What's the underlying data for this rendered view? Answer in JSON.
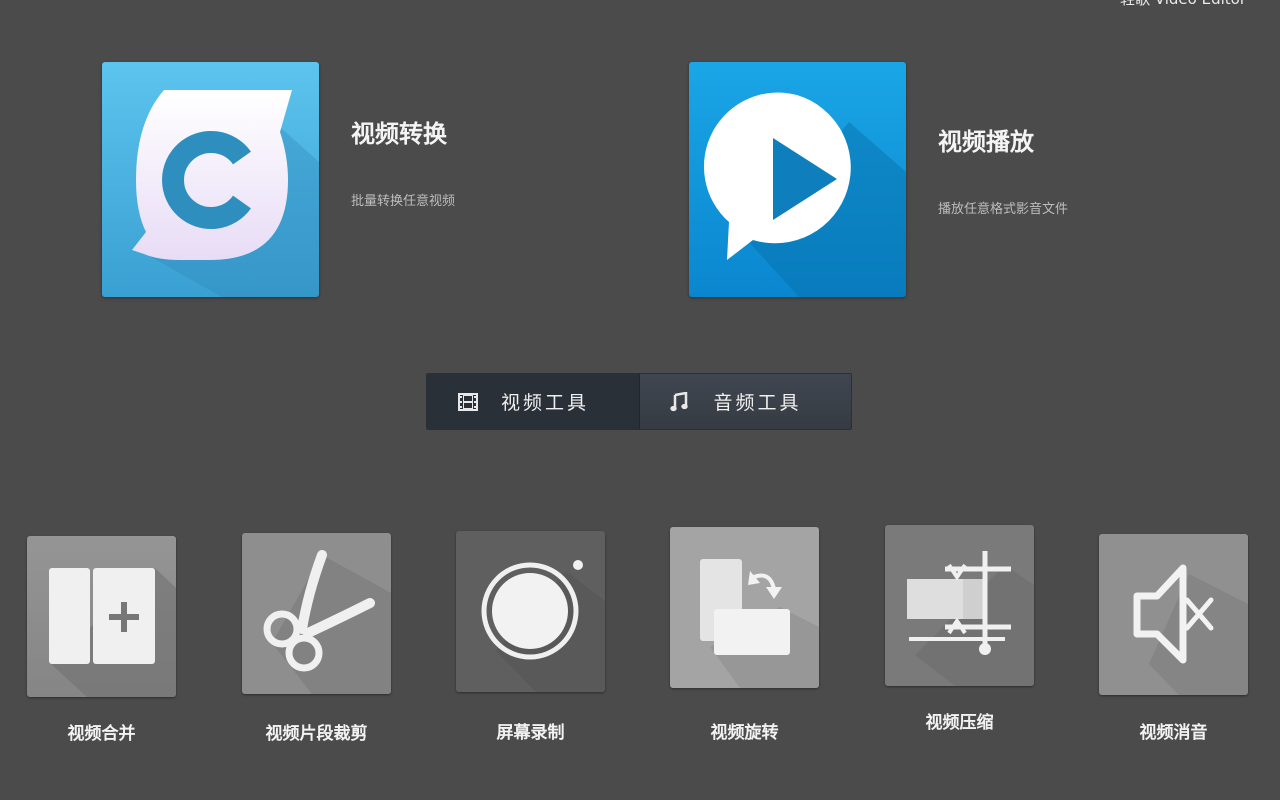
{
  "app": {
    "title": "轻歌 Video Editor"
  },
  "features": [
    {
      "name": "视频转换",
      "description": "批量转换任意视频",
      "icon": "convert-c-icon",
      "color": "#3aaee0"
    },
    {
      "name": "视频播放",
      "description": "播放任意格式影音文件",
      "icon": "play-bubble-icon",
      "color": "#0d9be0"
    }
  ],
  "tabs": [
    {
      "label": "视频工具",
      "icon": "film-strip-icon",
      "active": true
    },
    {
      "label": "音频工具",
      "icon": "music-note-icon",
      "active": false
    }
  ],
  "tools": [
    {
      "label": "视频合并",
      "icon": "merge-panels-icon"
    },
    {
      "label": "视频片段裁剪",
      "icon": "scissors-icon"
    },
    {
      "label": "屏幕录制",
      "icon": "record-circle-icon"
    },
    {
      "label": "视频旋转",
      "icon": "rotate-icon"
    },
    {
      "label": "视频压缩",
      "icon": "compress-icon"
    },
    {
      "label": "视频消音",
      "icon": "mute-speaker-icon"
    }
  ],
  "colors": {
    "background": "#4b4b4b",
    "tool_tile": "#8a8a8a",
    "segment_active": "#2a3038"
  }
}
